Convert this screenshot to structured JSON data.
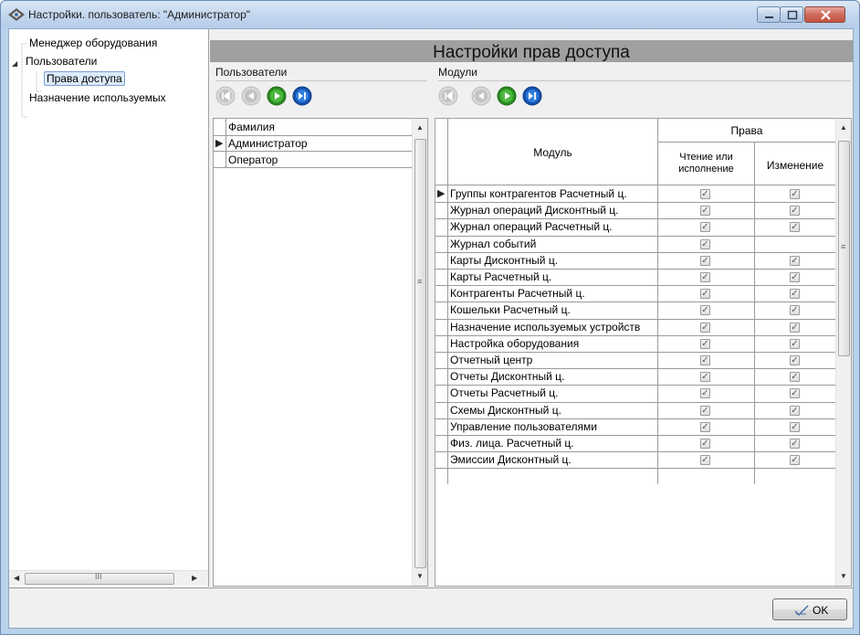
{
  "window": {
    "title": "Настройки. пользователь: \"Администратор\"",
    "icon": "settings-diamond-icon"
  },
  "tree": {
    "items": [
      {
        "label": "Менеджер оборудования",
        "level": 0
      },
      {
        "label": "Пользователи",
        "level": 0,
        "expanded": true
      },
      {
        "label": "Права доступа",
        "level": 1,
        "selected": true
      },
      {
        "label": "Назначение используемых",
        "level": 0
      }
    ]
  },
  "header": {
    "title": "Настройки прав доступа"
  },
  "users": {
    "group_label": "Пользователи",
    "column": "Фамилия",
    "rows": [
      "Администратор",
      "Оператор"
    ],
    "selected_index": 0
  },
  "modules": {
    "group_label": "Модули",
    "col_module": "Модуль",
    "col_rights": "Права",
    "col_read": "Чтение или исполнение",
    "col_read_line1": "Чтение или",
    "col_read_line2": "исполнение",
    "col_edit": "Изменение",
    "rows": [
      {
        "name": "Группы контрагентов Расчетный ц.",
        "read": true,
        "edit": true
      },
      {
        "name": "Журнал операций Дисконтный ц.",
        "read": true,
        "edit": true
      },
      {
        "name": "Журнал операций Расчетный ц.",
        "read": true,
        "edit": true
      },
      {
        "name": "Журнал событий",
        "read": true,
        "edit": false
      },
      {
        "name": "Карты Дисконтный ц.",
        "read": true,
        "edit": true
      },
      {
        "name": "Карты Расчетный ц.",
        "read": true,
        "edit": true
      },
      {
        "name": "Контрагенты Расчетный ц.",
        "read": true,
        "edit": true
      },
      {
        "name": "Кошельки Расчетный ц.",
        "read": true,
        "edit": true
      },
      {
        "name": "Назначение используемых устройств",
        "read": true,
        "edit": true
      },
      {
        "name": "Настройка оборудования",
        "read": true,
        "edit": true
      },
      {
        "name": "Отчетный центр",
        "read": true,
        "edit": true
      },
      {
        "name": "Отчеты Дисконтный ц.",
        "read": true,
        "edit": true
      },
      {
        "name": "Отчеты Расчетный ц.",
        "read": true,
        "edit": true
      },
      {
        "name": "Схемы Дисконтный ц.",
        "read": true,
        "edit": true
      },
      {
        "name": "Управление пользователями",
        "read": true,
        "edit": true
      },
      {
        "name": "Физ. лица. Расчетный ц.",
        "read": true,
        "edit": true
      },
      {
        "name": "Эмиссии Дисконтный ц.",
        "read": true,
        "edit": true
      }
    ]
  },
  "footer": {
    "ok_label": "OK"
  },
  "colors": {
    "nav_disabled": "#c8c8c8",
    "nav_green": "#3aa52e",
    "nav_blue": "#1f6fd6",
    "header_bar": "#a0a0a0"
  }
}
